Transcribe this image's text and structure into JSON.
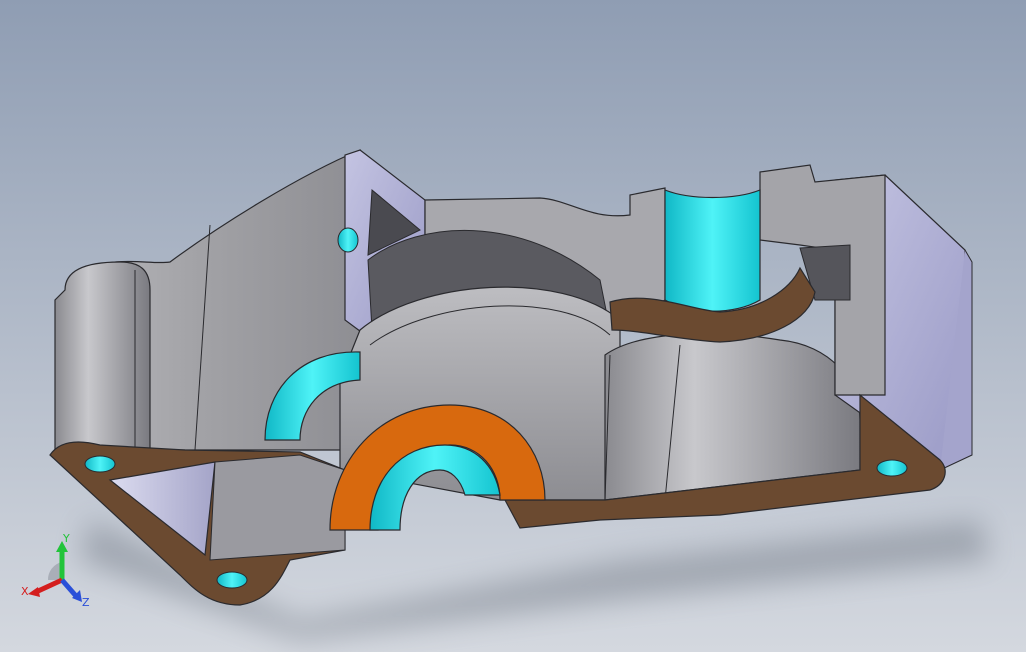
{
  "viewport": {
    "background_top": "#8f9db3",
    "background_bottom": "#d4d8df"
  },
  "model": {
    "colors": {
      "body_light": "#c9c9cc",
      "body_mid": "#a7a7ab",
      "body_dark": "#7d7d82",
      "lavender": "#b6b6d8",
      "lavender_dark": "#9a9ac4",
      "section_brown": "#6b4a30",
      "section_orange": "#d8690e",
      "bore_cyan": "#27e6ee",
      "bore_cyan_dark": "#12b9c7"
    }
  },
  "triad": {
    "x_label": "X",
    "y_label": "Y",
    "z_label": "Z",
    "x_color": "#d41e1e",
    "y_color": "#22c43a",
    "z_color": "#2a4fd8"
  }
}
